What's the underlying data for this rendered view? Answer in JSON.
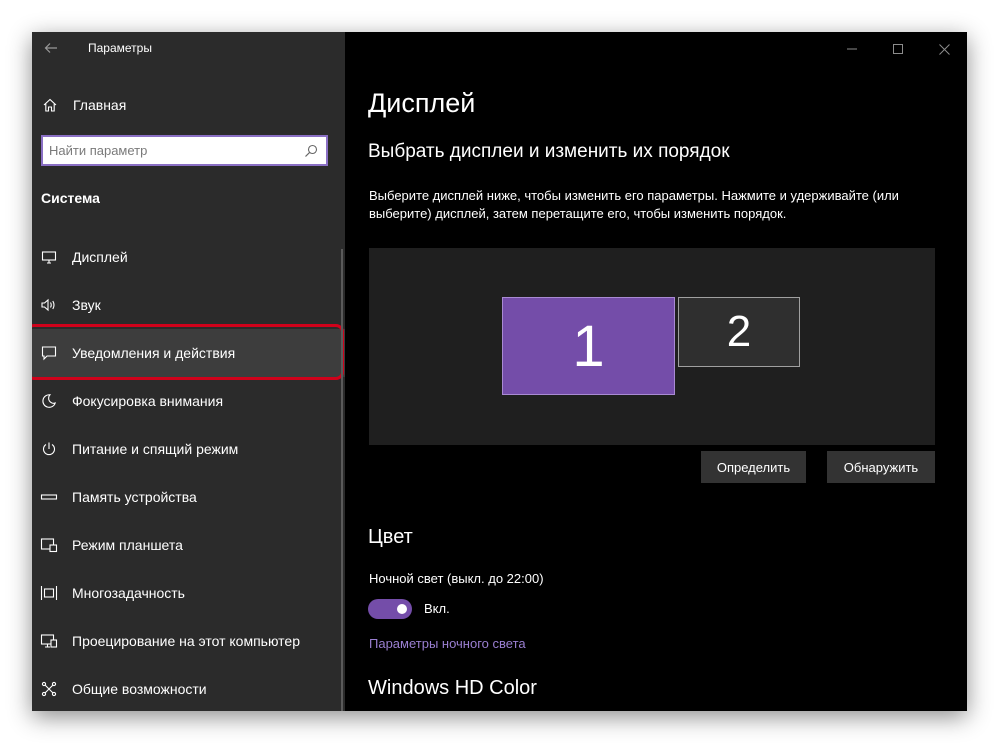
{
  "window": {
    "title": "Параметры"
  },
  "sidebar": {
    "home_label": "Главная",
    "search": {
      "placeholder": "Найти параметр",
      "value": ""
    },
    "section_title": "Система",
    "items": [
      {
        "label": "Дисплей",
        "icon": "monitor-icon"
      },
      {
        "label": "Звук",
        "icon": "speaker-icon"
      },
      {
        "label": "Уведомления и действия",
        "icon": "notification-icon",
        "selected": true,
        "highlighted": true
      },
      {
        "label": "Фокусировка внимания",
        "icon": "moon-icon"
      },
      {
        "label": "Питание и спящий режим",
        "icon": "power-icon"
      },
      {
        "label": "Память устройства",
        "icon": "storage-icon"
      },
      {
        "label": "Режим планшета",
        "icon": "tablet-mode-icon"
      },
      {
        "label": "Многозадачность",
        "icon": "multitasking-icon"
      },
      {
        "label": "Проецирование на этот компьютер",
        "icon": "project-icon"
      },
      {
        "label": "Общие возможности",
        "icon": "shared-experiences-icon"
      }
    ]
  },
  "main": {
    "title": "Дисплей",
    "subtitle": "Выбрать дисплеи и изменить их порядок",
    "description": "Выберите дисплей ниже, чтобы изменить его параметры. Нажмите и удерживайте (или выберите) дисплей, затем перетащите его, чтобы изменить порядок.",
    "monitors": [
      {
        "label": "1",
        "selected": true
      },
      {
        "label": "2",
        "selected": false
      }
    ],
    "identify_button": "Определить",
    "detect_button": "Обнаружить",
    "color_heading": "Цвет",
    "night_light_label": "Ночной свет (выкл. до 22:00)",
    "night_light_toggle": {
      "state": "on",
      "label": "Вкл."
    },
    "night_light_link": "Параметры ночного света",
    "hdr_heading": "Windows HD Color"
  },
  "colors": {
    "accent": "#744da9",
    "link": "#9a7fd1",
    "sidebar_bg": "#2b2b2b",
    "main_bg": "#000000",
    "highlight_ring": "#d0021b"
  }
}
